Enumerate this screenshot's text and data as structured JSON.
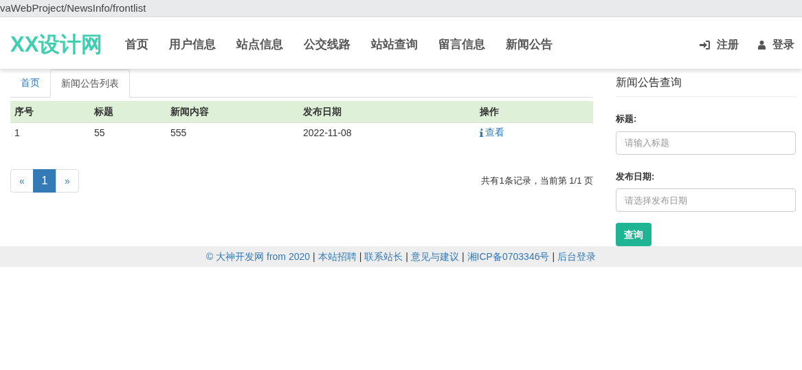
{
  "address_bar": {
    "url": "vaWebProject/NewsInfo/frontlist"
  },
  "navbar": {
    "logo": "XX设计网",
    "items": [
      {
        "label": "首页"
      },
      {
        "label": "用户信息"
      },
      {
        "label": "站点信息"
      },
      {
        "label": "公交线路"
      },
      {
        "label": "站站查询"
      },
      {
        "label": "留言信息"
      },
      {
        "label": "新闻公告"
      }
    ],
    "actions": [
      {
        "kind": "register",
        "label": "注册"
      },
      {
        "kind": "login",
        "label": "登录"
      }
    ]
  },
  "tabs": [
    {
      "label": "首页",
      "selected": false
    },
    {
      "label": "新闻公告列表",
      "selected": true
    }
  ],
  "table": {
    "columns": [
      "序号",
      "标题",
      "新闻内容",
      "发布日期",
      "操作"
    ],
    "rows": [
      {
        "cells": [
          "1",
          "55",
          "555",
          "2022-11-08"
        ],
        "action": "查看"
      }
    ]
  },
  "pagination": {
    "prev": "«",
    "pages": [
      {
        "label": "1",
        "selected": true
      }
    ],
    "next": "»",
    "summary": "共有1条记录，当前第 1/1 页"
  },
  "search_panel": {
    "title": "新闻公告查询",
    "fields": [
      {
        "label": "标题:",
        "placeholder": "请输入标题"
      },
      {
        "label": "发布日期:",
        "placeholder": "请选择发布日期"
      }
    ],
    "button": "查询"
  },
  "footer": {
    "separator": "|",
    "links": [
      "© 大神开发网 from 2020",
      "本站招聘",
      "联系站长",
      "意见与建议",
      "湘ICP备0703346号",
      "后台登录"
    ]
  }
}
